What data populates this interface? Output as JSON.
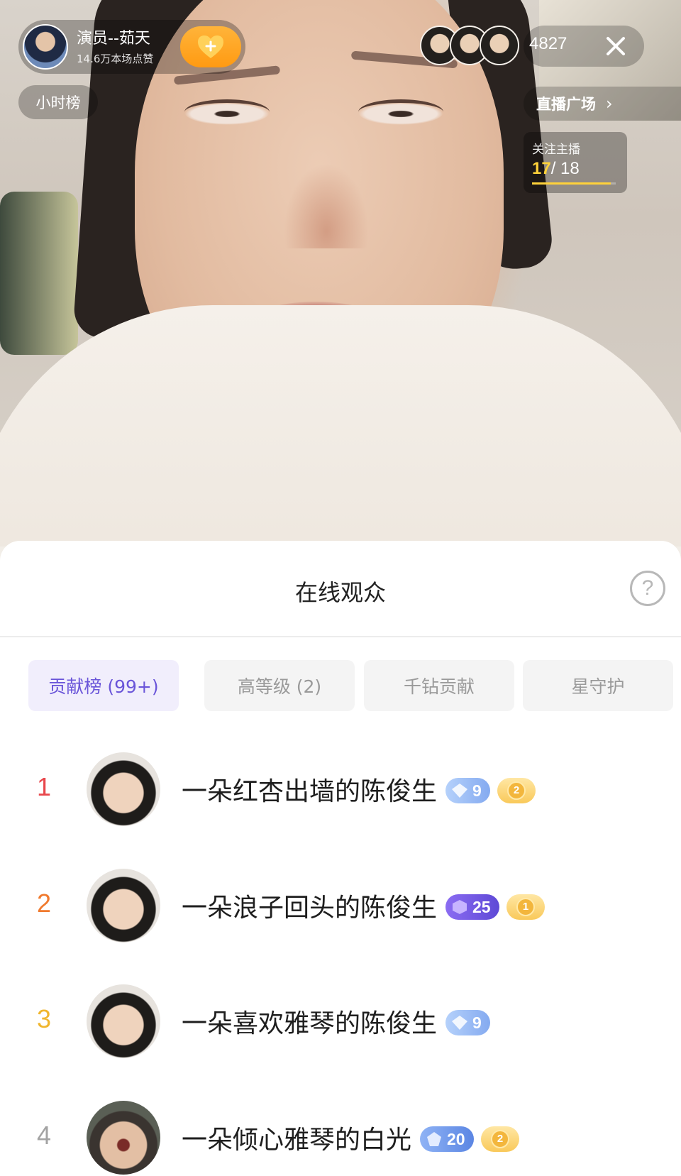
{
  "host": {
    "name": "演员--茹天",
    "likes": "14.6万本场点赞"
  },
  "top_bar": {
    "viewer_count": "4827"
  },
  "overlay": {
    "hour_rank": "小时榜",
    "plaza_label": "直播广场",
    "follow_card": {
      "label": "关注主播",
      "current": "17",
      "total": "/ 18",
      "progress_fraction": 0.944
    }
  },
  "sheet": {
    "title": "在线观众",
    "help": "?",
    "tabs": [
      {
        "label": "贡献榜 (99+)",
        "active": true
      },
      {
        "label": "高等级 (2)",
        "active": false
      },
      {
        "label": "千钻贡献",
        "active": false
      },
      {
        "label": "星守护",
        "active": false
      }
    ],
    "rows": [
      {
        "rank": "1",
        "rank_color": "#e8474c",
        "name": "一朵红杏出墙的陈俊生",
        "level": "9",
        "level_style": "blue",
        "coin": "2"
      },
      {
        "rank": "2",
        "rank_color": "#f07a2e",
        "name": "一朵浪子回头的陈俊生",
        "level": "25",
        "level_style": "purple",
        "coin": "1"
      },
      {
        "rank": "3",
        "rank_color": "#f0b62e",
        "name": "一朵喜欢雅琴的陈俊生",
        "level": "9",
        "level_style": "blue",
        "coin": ""
      },
      {
        "rank": "4",
        "rank_color": "#a3a3a3",
        "name": "一朵倾心雅琴的白光",
        "level": "20",
        "level_style": "teal",
        "coin": "2"
      }
    ]
  },
  "icons": {
    "follow": "heart-plus-icon",
    "close": "close-icon",
    "plaza_arrow": "chevron-right-icon",
    "help": "question-circle-icon",
    "level": "diamond-icon",
    "coin": "coin-badge-icon"
  },
  "colors": {
    "accent": "#6a55d9",
    "follow_button": "#ff9a12",
    "progress": "#ffd23a"
  }
}
